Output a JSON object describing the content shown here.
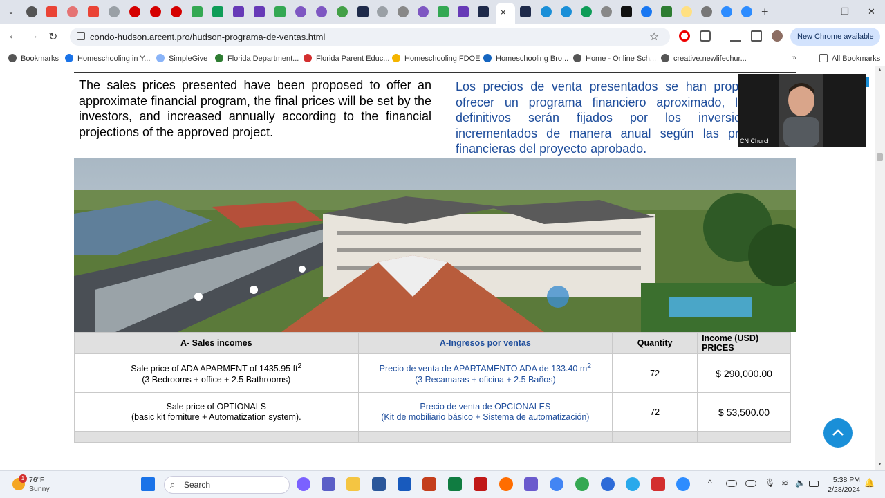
{
  "browser": {
    "url": "condo-hudson.arcent.pro/hudson-programa-de-ventas.html",
    "update_label": "New Chrome available",
    "tab_close": "×",
    "new_tab": "+",
    "tab_search": "⌄"
  },
  "bookmarks": [
    {
      "label": "Bookmarks",
      "color": "#555"
    },
    {
      "label": "Homeschooling in Y...",
      "color": "#1a73e8"
    },
    {
      "label": "SimpleGive",
      "color": "#8ab4f8"
    },
    {
      "label": "Florida Department...",
      "color": "#2e7d32"
    },
    {
      "label": "Florida Parent Educ...",
      "color": "#d32f2f"
    },
    {
      "label": "Homeschooling FDOE",
      "color": "#f4b400"
    },
    {
      "label": "Homeschooling Bro...",
      "color": "#1565c0"
    },
    {
      "label": "Home - Online Sch...",
      "color": "#555"
    },
    {
      "label": "creative.newlifechur...",
      "color": "#555"
    }
  ],
  "all_bookmarks": "All Bookmarks",
  "content": {
    "english_paragraph": "The sales prices presented have been proposed to offer an approximate financial program, the final prices will be set by the investors, and increased annually according to the financial projections of the approved project.",
    "spanish_paragraph": "Los precios de venta presentados se han propuesto para ofrecer un programa financiero aproximado, los precios definitivos serán fijados por los inversionistas, e incrementados de manera anual según las proyecciones financieras del proyecto aprobado."
  },
  "table": {
    "headers": [
      "A- Sales incomes",
      "A-Ingresos por ventas",
      "Quantity",
      "Income (USD) PRICES"
    ],
    "rows": [
      {
        "en_line1": "Sale price of ADA APARMENT of 1435.95 ft",
        "en_sup": "2",
        "en_line2": "(3 Bedrooms + office + 2.5 Bathrooms)",
        "es_line1": "Precio de venta de APARTAMENTO ADA de 133.40 m",
        "es_sup": "2",
        "es_line2": "(3 Recamaras + oficina + 2.5 Baños)",
        "quantity": "72",
        "price": "$ 290,000.00"
      },
      {
        "en_line1": "Sale price of OPTIONALS",
        "en_sup": "",
        "en_line2": "(basic kit forniture + Automatization system).",
        "es_line1": "Precio de venta de OPCIONALES",
        "es_sup": "",
        "es_line2": "(Kit de mobiliario básico + Sistema de automatización)",
        "quantity": "72",
        "price": "$ 53,500.00"
      }
    ]
  },
  "video": {
    "name": "CN Church"
  },
  "taskbar": {
    "weather_temp": "76°F",
    "weather_desc": "Sunny",
    "weather_badge": "1",
    "search_placeholder": "Search",
    "time": "5:38 PM",
    "date": "2/28/2024"
  },
  "colors": {
    "accent": "#1a8fd8",
    "spanish_text": "#1f4e9c",
    "table_header": "#e0e0e0"
  }
}
